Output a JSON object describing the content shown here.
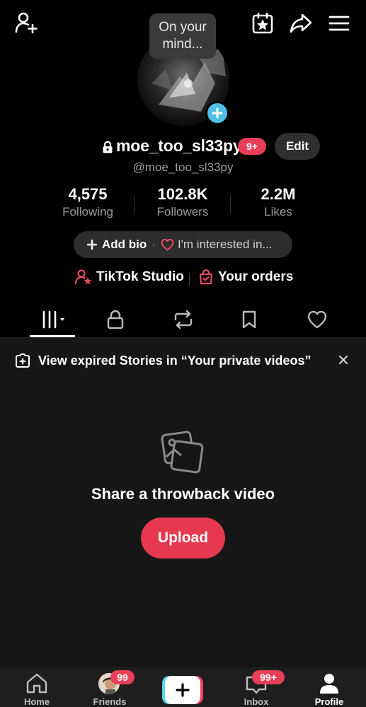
{
  "profile": {
    "avatar_bubble": "On your mind...",
    "username": "moe_too_sl33py",
    "notification_badge": "9+",
    "edit_label": "Edit",
    "handle": "@moe_too_sl33py"
  },
  "stats": [
    {
      "value": "4,575",
      "label": "Following"
    },
    {
      "value": "102.8K",
      "label": "Followers"
    },
    {
      "value": "2.2M",
      "label": "Likes"
    }
  ],
  "bio": {
    "add_bio_label": "Add bio",
    "separator": "·",
    "interest_label": "I'm interested in..."
  },
  "links": {
    "studio_label": "TikTok Studio",
    "orders_label": "Your orders"
  },
  "tabs": [
    {
      "name": "videos",
      "icon": "grid-bars-icon"
    },
    {
      "name": "private",
      "icon": "lock-icon"
    },
    {
      "name": "reposts",
      "icon": "repost-icon"
    },
    {
      "name": "saved",
      "icon": "bookmark-icon"
    },
    {
      "name": "liked",
      "icon": "heart-icon"
    }
  ],
  "banner": {
    "text": "View expired Stories in “Your private videos”"
  },
  "empty_state": {
    "title": "Share a throwback video",
    "upload_label": "Upload"
  },
  "bottom_nav": {
    "home_label": "Home",
    "friends_label": "Friends",
    "friends_badge": "99",
    "inbox_label": "Inbox",
    "inbox_badge": "99+",
    "profile_label": "Profile"
  },
  "colors": {
    "accent_red": "#e83e57",
    "plus_blue": "#4fc1e9",
    "background": "#000000"
  }
}
